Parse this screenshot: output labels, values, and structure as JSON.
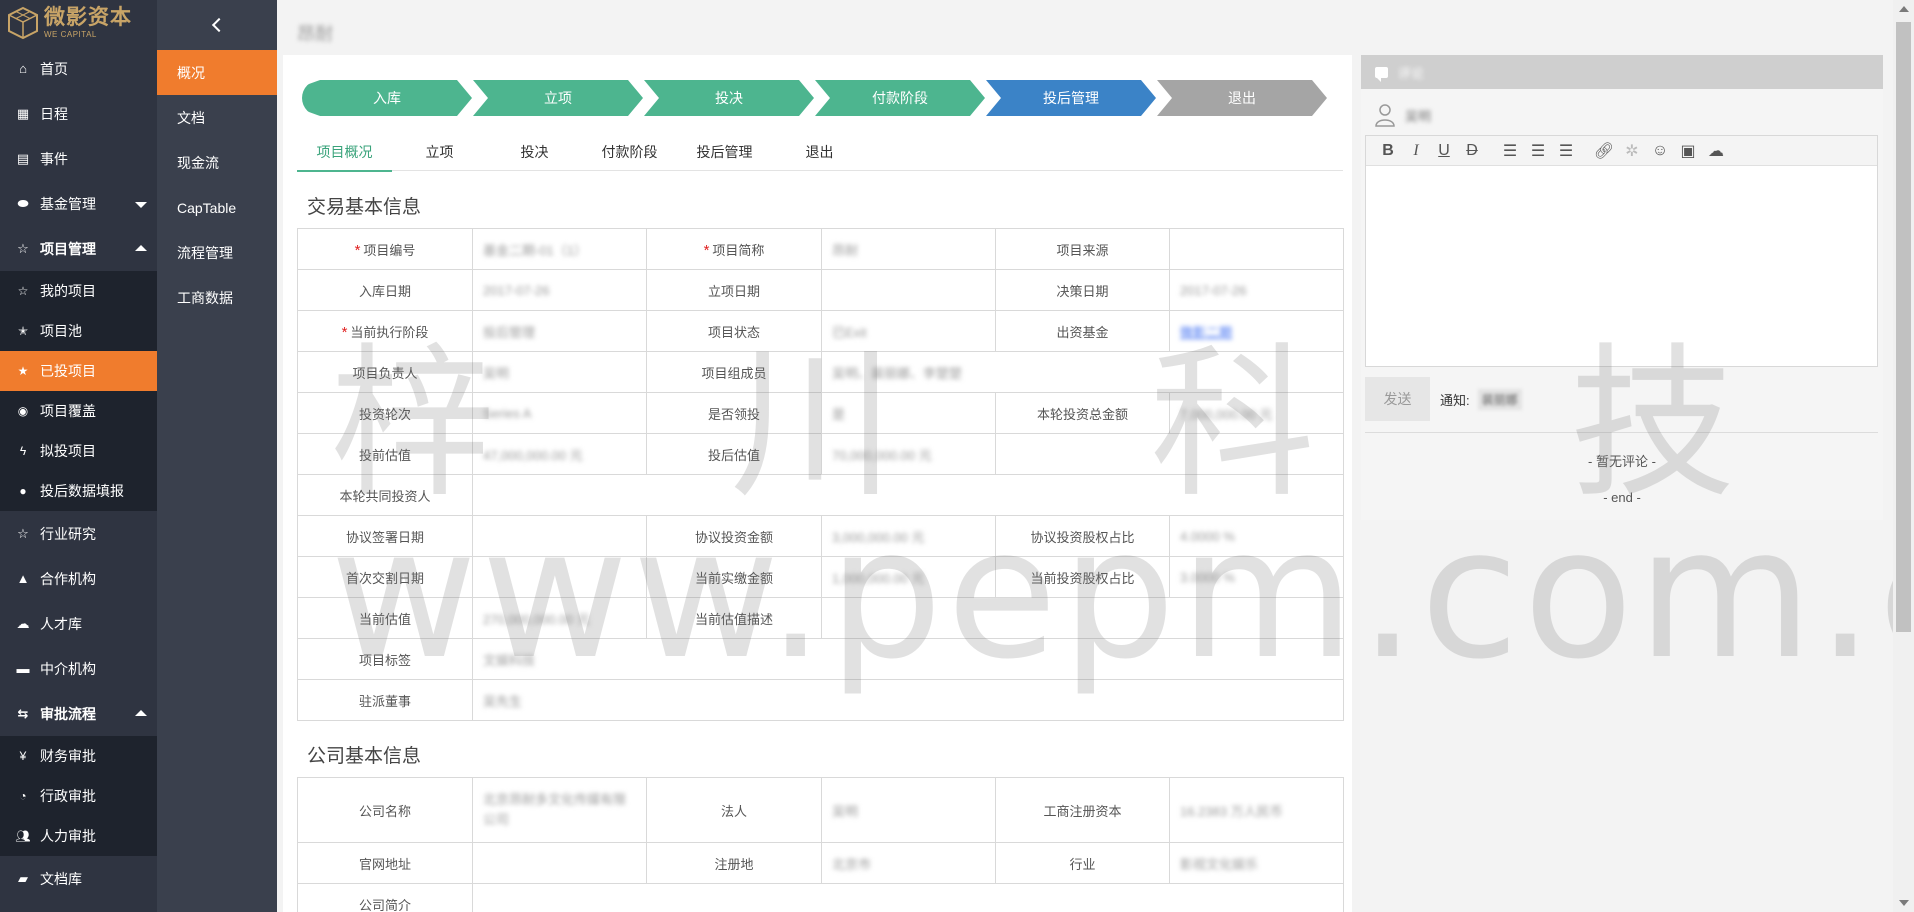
{
  "brand": {
    "name_cn": "微影资本",
    "name_en": "WE CAPITAL"
  },
  "sidebar": {
    "items": [
      {
        "label": "首页",
        "icon": "home-icon"
      },
      {
        "label": "日程",
        "icon": "calendar-icon"
      },
      {
        "label": "事件",
        "icon": "clipboard-icon"
      },
      {
        "label": "基金管理",
        "icon": "database-icon"
      },
      {
        "label": "项目管理",
        "icon": "star-icon"
      },
      {
        "label": "行业研究",
        "icon": "star-outline-icon"
      },
      {
        "label": "合作机构",
        "icon": "road-icon"
      },
      {
        "label": "人才库",
        "icon": "cloud-icon"
      },
      {
        "label": "中介机构",
        "icon": "car-icon"
      },
      {
        "label": "审批流程",
        "icon": "exchange-icon"
      },
      {
        "label": "文档库",
        "icon": "folder-icon"
      }
    ],
    "project_sub": [
      {
        "label": "我的项目",
        "icon": "star-outline-icon"
      },
      {
        "label": "项目池",
        "icon": "star-half-icon"
      },
      {
        "label": "已投项目",
        "icon": "star-icon"
      },
      {
        "label": "项目覆盖",
        "icon": "dot-circle-icon"
      },
      {
        "label": "拟投项目",
        "icon": "bolt-icon"
      },
      {
        "label": "投后数据填报",
        "icon": "drop-icon"
      }
    ],
    "approval_sub": [
      {
        "label": "财务审批",
        "icon": "yen-icon"
      },
      {
        "label": "行政审批",
        "icon": "pie-icon"
      },
      {
        "label": "人力审批",
        "icon": "users-icon"
      }
    ]
  },
  "subnav": {
    "items": [
      "概况",
      "文档",
      "现金流",
      "CapTable",
      "流程管理",
      "工商数据"
    ]
  },
  "page": {
    "title": "昂耐"
  },
  "steps": [
    "入库",
    "立项",
    "投决",
    "付款阶段",
    "投后管理",
    "退出"
  ],
  "tabs": [
    "项目概况",
    "立项",
    "投决",
    "付款阶段",
    "投后管理",
    "退出"
  ],
  "trade": {
    "title": "交易基本信息",
    "labels": {
      "code": "项目编号",
      "short": "项目简称",
      "source": "项目来源",
      "entry_date": "入库日期",
      "setup_date": "立项日期",
      "decision_date": "决策日期",
      "stage": "当前执行阶段",
      "status": "项目状态",
      "fund": "出资基金",
      "owner": "项目负责人",
      "members": "项目组成员",
      "round": "投资轮次",
      "lead": "是否领投",
      "round_total": "本轮投资总金额",
      "pre": "投前估值",
      "post": "投后估值",
      "co_investors": "本轮共同投资人",
      "sign_date": "协议签署日期",
      "agreed_amount": "协议投资金额",
      "agreed_ratio": "协议投资股权占比",
      "first_close": "首次交割日期",
      "paid": "当前实缴金额",
      "cur_ratio": "当前投资股权占比",
      "cur_val": "当前估值",
      "cur_val_desc": "当前估值描述",
      "tags": "项目标签",
      "director": "驻派董事"
    },
    "values": {
      "code": "基金二期-01（1）",
      "short": "昂耐",
      "entry_date": "2017-07-26",
      "decision_date": "2017-07-26",
      "stage": "投后管理",
      "status": "已Exit",
      "fund": "微影二期",
      "owner": "吴明",
      "members": "吴明、裴丽娜、李楚楚",
      "round": "Series A",
      "lead": "是",
      "round_total": "7,000,000.00 元",
      "pre": "47,000,000.00 元",
      "post": "70,000,000.00 元",
      "agreed_amount": "3,000,000.00 元",
      "agreed_ratio": "4.0000 %",
      "paid": "1,000,000.00 元",
      "cur_ratio": "3.0000 %",
      "cur_val": "270,000,000.00 元",
      "tags": "文娱科技",
      "director": "吴先生"
    }
  },
  "company": {
    "title": "公司基本信息",
    "labels": {
      "name": "公司名称",
      "legal": "法人",
      "capital": "工商注册资本",
      "site": "官网地址",
      "reg_place": "注册地",
      "industry": "行业",
      "intro": "公司简介"
    },
    "values": {
      "name": "北京昂耐多文化传媒有限公司",
      "legal": "吴明",
      "capital": "16.2383 万人民币",
      "reg_place": "北京市",
      "industry": "影视文化娱乐"
    }
  },
  "comment": {
    "title": "评论",
    "user": "吴明",
    "send": "发送",
    "notify_label": "通知:",
    "notify_user": "裴丽娜",
    "empty": "- 暂无评论 -",
    "end": "- end -"
  },
  "watermark": {
    "cn": [
      "梓",
      "川",
      "科",
      "技"
    ],
    "url": "www.pepm.com.cn"
  },
  "colors": {
    "accent": "#f07c2d",
    "done": "#4db58f",
    "current": "#3b83c7",
    "todo": "#a5a5a5"
  }
}
